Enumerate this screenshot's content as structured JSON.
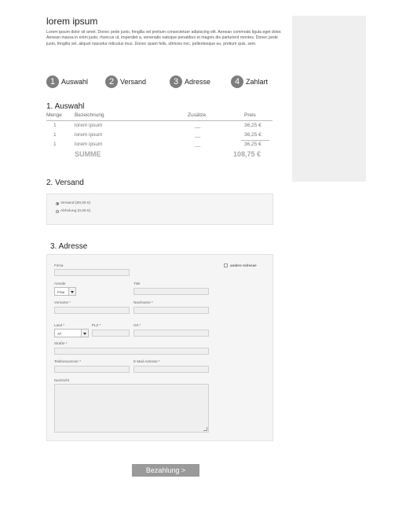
{
  "page": {
    "title": "lorem ipsum",
    "intro": "Lorem ipsum dolor sit amet. Donec pede justo, fringilla vel pretium consectetuer adipiscing elit. Aenean commodo ligula eget dolor. Aenean massa in enim justo, rhoncus ut, imperdiet a, venenatis natoque penatibus et magnis dis parturient montes. Donec pede justo, fringilla vel, aliquet nascetur ridiculus mus. Donec quam felis, ultricies nec, pellentesque eu, pretium quis, sem."
  },
  "steps": [
    {
      "num": "1",
      "label": "Auswahl"
    },
    {
      "num": "2",
      "label": "Versand"
    },
    {
      "num": "3",
      "label": "Adresse"
    },
    {
      "num": "4",
      "label": "Zahlart"
    }
  ],
  "selection": {
    "title": "1. Auswahl",
    "headers": {
      "qty": "Menge",
      "desc": "Bezeichnung",
      "extras": "Zusätze",
      "price": "Preis"
    },
    "rows": [
      {
        "qty": "1",
        "desc": "lorem ipsum",
        "extras": "__",
        "price": "36,25 €"
      },
      {
        "qty": "1",
        "desc": "lorem ipsum",
        "extras": "__",
        "price": "36,25 €"
      },
      {
        "qty": "1",
        "desc": "lorem ipsum",
        "extras": "__",
        "price": "36,25 €"
      }
    ],
    "sum_label": "SUMME",
    "sum_value": "108,75 €"
  },
  "shipping": {
    "title": "2. Versand",
    "options": [
      {
        "label": "Versand (80,00 €)",
        "selected": true
      },
      {
        "label": "Abholung (0,00 €)",
        "selected": false
      }
    ]
  },
  "address": {
    "title": "3. Adresse",
    "company": "Firma",
    "other_address": "andere Adresse",
    "salutation": "Anrede",
    "salutation_value": "Frau",
    "title_field": "Titel",
    "first_name": "Vorname *",
    "last_name": "Nachname *",
    "country": "Land *",
    "country_value": "AT",
    "zip": "PLZ *",
    "city": "Ort *",
    "street": "Straße *",
    "phone": "Telefonnummer *",
    "email": "E-Mail-Adresse *",
    "message": "Nachricht"
  },
  "payment_button": "Bezahlung >",
  "colors": {
    "step_circle": "#7d7d7d",
    "button": "#9a9a9a",
    "sidebar": "#efefef"
  }
}
